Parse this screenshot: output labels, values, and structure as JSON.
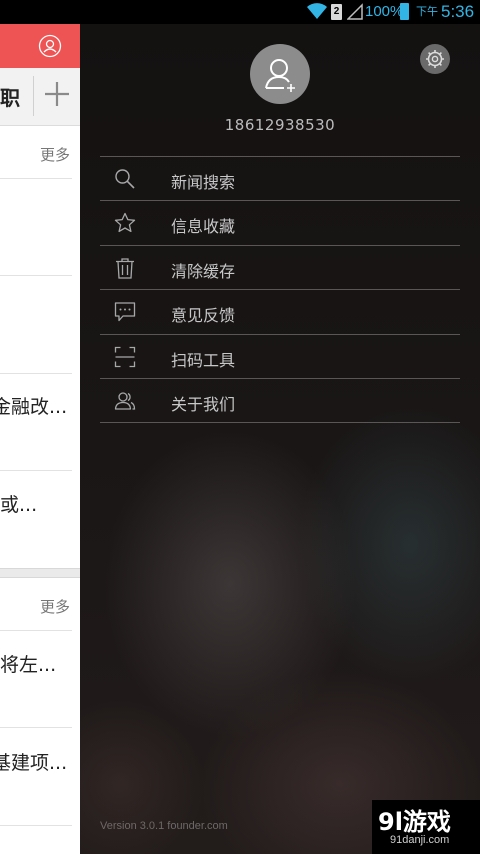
{
  "status_bar": {
    "sim_label": "2",
    "battery_percent": "100%",
    "ampm": "下午",
    "time": "5:36"
  },
  "content_page": {
    "active_tab": "职",
    "sections": [
      {
        "more_label": "更多",
        "headlines": [
          "",
          "",
          "金融改...",
          "或..."
        ]
      },
      {
        "more_label": "更多",
        "headlines": [
          "将左...",
          "基建项..."
        ]
      }
    ]
  },
  "drawer": {
    "phone": "18612938530",
    "menu": [
      {
        "label": "新闻搜索",
        "icon": "search-icon"
      },
      {
        "label": "信息收藏",
        "icon": "star-icon"
      },
      {
        "label": "清除缓存",
        "icon": "trash-icon"
      },
      {
        "label": "意见反馈",
        "icon": "feedback-icon"
      },
      {
        "label": "扫码工具",
        "icon": "scan-icon"
      },
      {
        "label": "关于我们",
        "icon": "users-icon"
      }
    ],
    "version": "Version 3.0.1 founder.com"
  },
  "watermark": {
    "main": "9l游戏",
    "sub": "91danji.com"
  },
  "colors": {
    "accent_red": "#ef5454",
    "status_blue": "#32b5e5",
    "drawer_text": "#c8c8c8"
  }
}
